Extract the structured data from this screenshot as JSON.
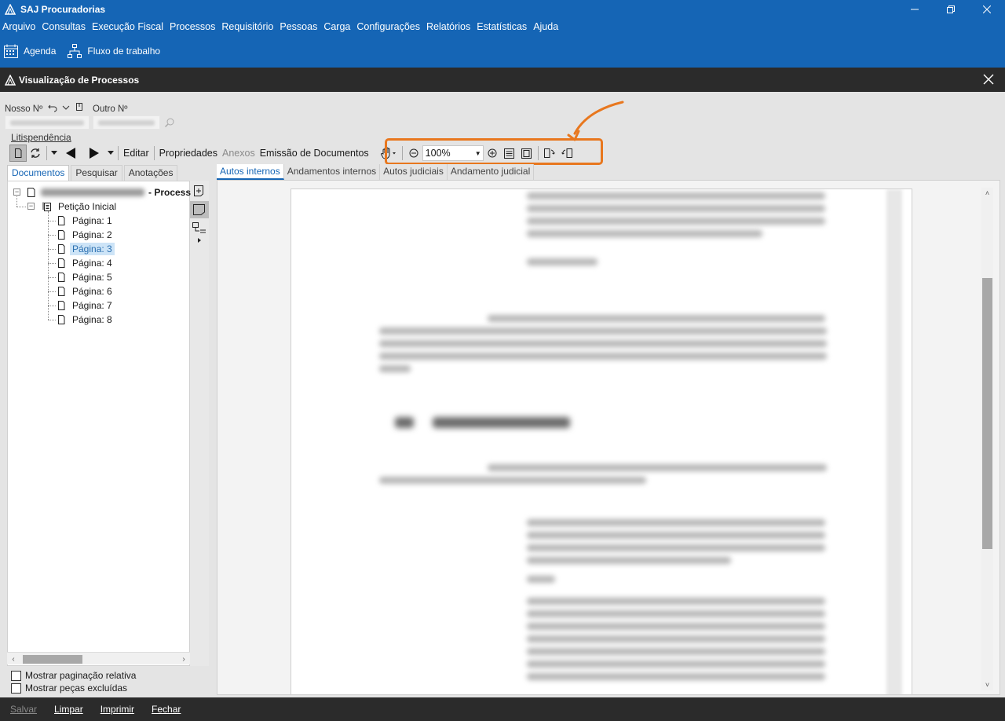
{
  "app": {
    "title": "SAJ Procuradorias"
  },
  "menu": [
    "Arquivo",
    "Consultas",
    "Execução Fiscal",
    "Processos",
    "Requisitório",
    "Pessoas",
    "Carga",
    "Configurações",
    "Relatórios",
    "Estatísticas",
    "Ajuda"
  ],
  "ribbon": {
    "agenda": "Agenda",
    "workflow": "Fluxo de trabalho"
  },
  "window": {
    "title": "Visualização de Processos"
  },
  "fields": {
    "nosso_label": "Nosso Nº",
    "outro_label": "Outro Nº"
  },
  "links": {
    "litispendencia": "Litispendência"
  },
  "toolbar": {
    "editar": "Editar",
    "propriedades": "Propriedades",
    "anexos": "Anexos",
    "emissao": "Emissão de Documentos",
    "zoom": "100%"
  },
  "left_tabs": [
    "Documentos",
    "Pesquisar",
    "Anotações"
  ],
  "tree": {
    "root_suffix": "- Process",
    "folder": "Petição Inicial",
    "pages": [
      "Página: 1",
      "Página: 2",
      "Página: 3",
      "Página: 4",
      "Página: 5",
      "Página: 6",
      "Página: 7",
      "Página: 8"
    ],
    "selected_page": "Página: 3"
  },
  "options": {
    "relative_pagination": "Mostrar paginação relativa",
    "deleted_pieces": "Mostrar peças excluídas"
  },
  "right_tabs": [
    "Autos internos",
    "Andamentos internos",
    "Autos judiciais",
    "Andamento judicial"
  ],
  "bottom": {
    "salvar": "Salvar",
    "limpar": "Limpar",
    "imprimir": "Imprimir",
    "fechar": "Fechar"
  },
  "colors": {
    "accent": "#1565b5",
    "highlight": "#e8771e",
    "dark_bar": "#2b2b2b"
  }
}
